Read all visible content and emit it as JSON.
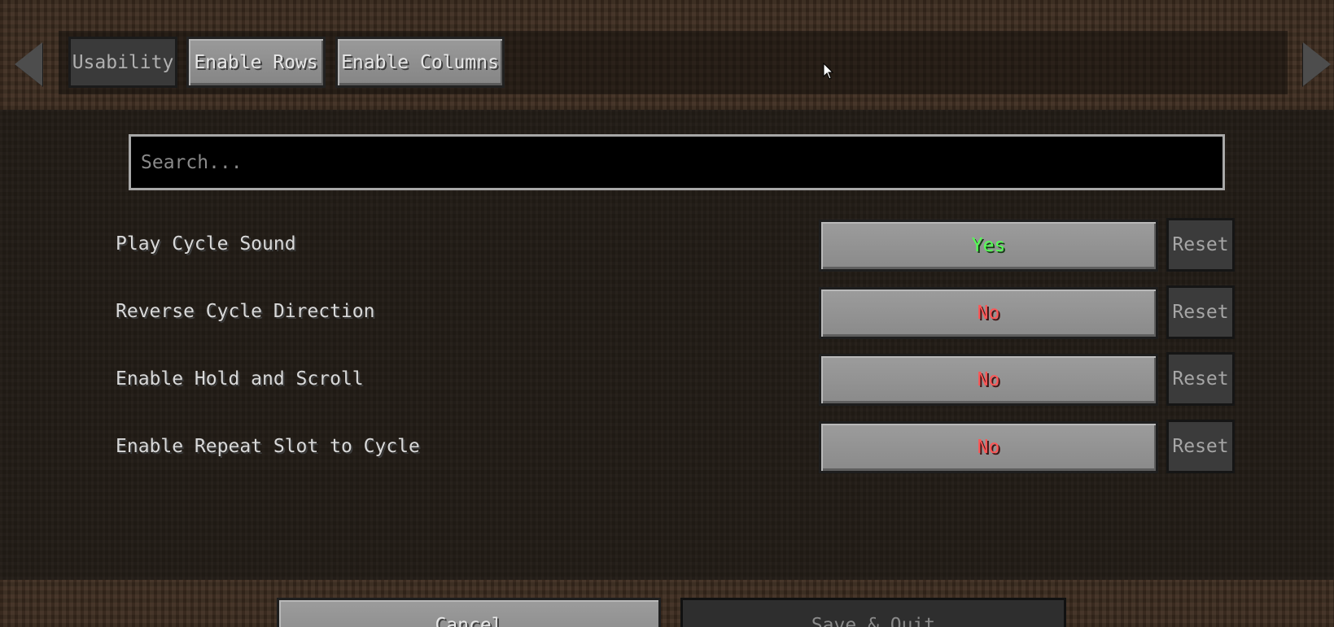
{
  "tabs": [
    {
      "label": "Usability",
      "active": true
    },
    {
      "label": "Enable Rows",
      "active": false
    },
    {
      "label": "Enable Columns",
      "active": false
    }
  ],
  "search": {
    "placeholder": "Search..."
  },
  "options": [
    {
      "label": "Play Cycle Sound",
      "value": "Yes",
      "reset": "Reset"
    },
    {
      "label": "Reverse Cycle Direction",
      "value": "No",
      "reset": "Reset"
    },
    {
      "label": "Enable Hold and Scroll",
      "value": "No",
      "reset": "Reset"
    },
    {
      "label": "Enable Repeat Slot to Cycle",
      "value": "No",
      "reset": "Reset"
    }
  ],
  "footer": {
    "cancel_label": "Cancel",
    "save_label": "Save & Quit"
  },
  "colors": {
    "yes": "#55ff55",
    "no": "#ff5555"
  },
  "icons": {
    "prev": "triangle-left-icon",
    "next": "triangle-right-icon",
    "cursor": "mouse-pointer-icon"
  }
}
